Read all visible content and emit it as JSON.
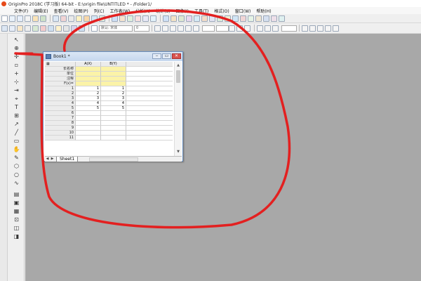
{
  "app": {
    "title": "OriginPro 2018C (学习版) 64-bit - E:\\origin file\\UNTITLED * - /Folder1/"
  },
  "menu": {
    "items": [
      "文件(F)",
      "编辑(E)",
      "查看(V)",
      "绘图(P)",
      "列(C)",
      "工作表(W)",
      "分析(A)",
      "统计(S)",
      "图像(I)",
      "工具(T)",
      "格式(O)",
      "窗口(W)",
      "帮助(H)"
    ]
  },
  "toolbar": {
    "font_combo": "默认: 宋体",
    "size_combo": "0"
  },
  "book": {
    "title": "Book1 *",
    "columns": [
      "A(X)",
      "B(Y)"
    ],
    "meta_rows": [
      "长名称",
      "单位",
      "注释",
      "F(x)="
    ],
    "data_rows": [
      {
        "num": "1",
        "a": "1",
        "b": "1"
      },
      {
        "num": "2",
        "a": "2",
        "b": "2"
      },
      {
        "num": "3",
        "a": "3",
        "b": "3"
      },
      {
        "num": "4",
        "a": "4",
        "b": "4"
      },
      {
        "num": "5",
        "a": "5",
        "b": "5"
      },
      {
        "num": "6",
        "a": "",
        "b": ""
      },
      {
        "num": "7",
        "a": "",
        "b": ""
      },
      {
        "num": "8",
        "a": "",
        "b": ""
      },
      {
        "num": "9",
        "a": "",
        "b": ""
      },
      {
        "num": "10",
        "a": "",
        "b": ""
      },
      {
        "num": "11",
        "a": "",
        "b": ""
      }
    ],
    "sheet_tab": "Sheet1"
  },
  "colors": {
    "annotation": "#e32020",
    "workspace": "#a8a8a8",
    "meta_cell": "#fbf3a8"
  }
}
